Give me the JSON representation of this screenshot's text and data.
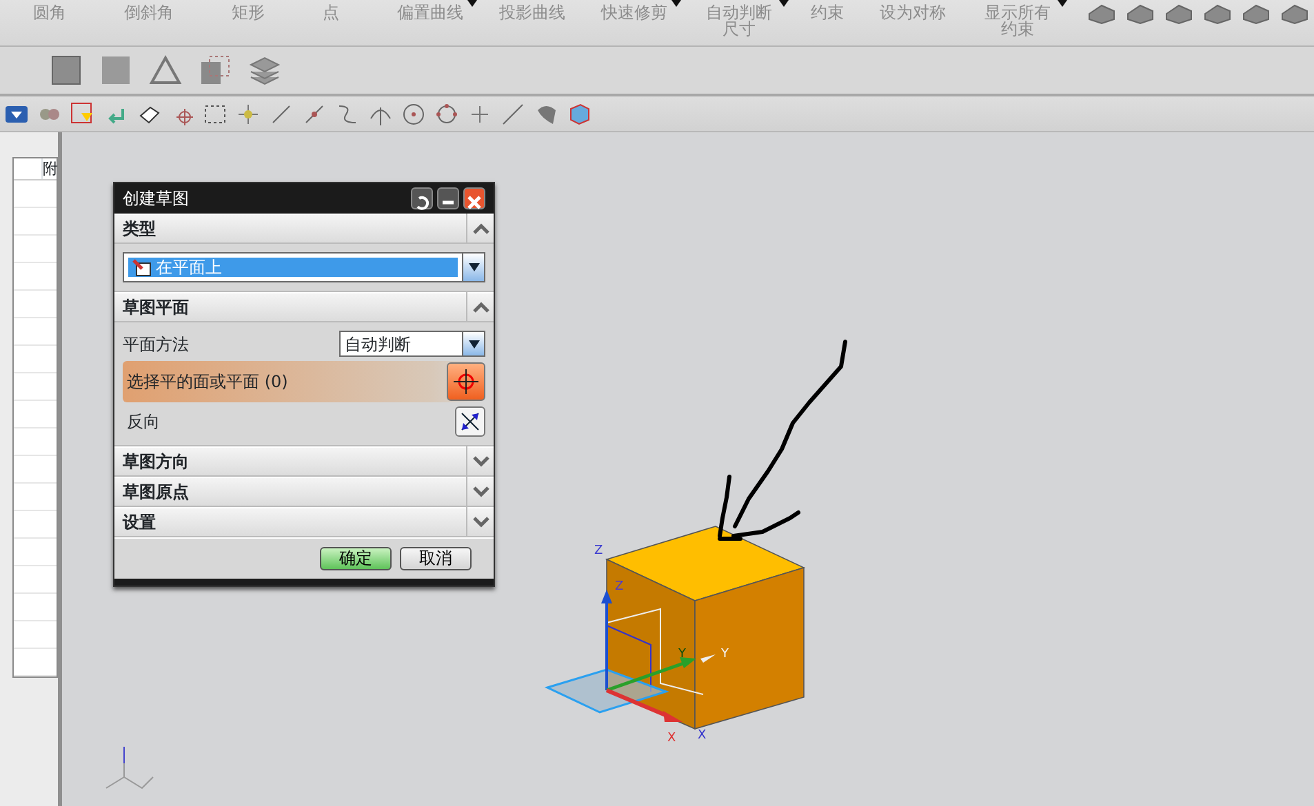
{
  "ribbon": {
    "commands": [
      {
        "label": "圆角",
        "dropdown": false
      },
      {
        "label": "倒斜角",
        "dropdown": false
      },
      {
        "label": "矩形",
        "dropdown": false
      },
      {
        "label": "点",
        "dropdown": false
      },
      {
        "label": "偏置曲线",
        "dropdown": true
      },
      {
        "label": "投影曲线",
        "dropdown": false
      },
      {
        "label": "快速修剪",
        "dropdown": true
      },
      {
        "label": "自动判断尺寸",
        "dropdown": true
      },
      {
        "label": "约束",
        "dropdown": false
      },
      {
        "label": "设为对称",
        "dropdown": false
      },
      {
        "label": "显示所有约束",
        "dropdown": true
      }
    ]
  },
  "side_table": {
    "columns": [
      "附"
    ]
  },
  "dialog": {
    "title": "创建草图",
    "sections": [
      {
        "title": "类型",
        "expanded": true,
        "kind": "type",
        "value": "在平面上"
      },
      {
        "title": "草图平面",
        "expanded": true,
        "kind": "plane",
        "method_label": "平面方法",
        "method_value": "自动判断",
        "select_label": "选择平的面或平面 (0)",
        "select_active": true,
        "reverse_label": "反向"
      },
      {
        "title": "草图方向",
        "expanded": false
      },
      {
        "title": "草图原点",
        "expanded": false
      },
      {
        "title": "设置",
        "expanded": false
      }
    ],
    "buttons": [
      {
        "label": "确定",
        "default": true
      },
      {
        "label": "取消",
        "default": false
      }
    ]
  },
  "viewport": {
    "axis_labels": [
      "Z",
      "Z",
      "Y",
      "Y",
      "X",
      "X"
    ]
  }
}
